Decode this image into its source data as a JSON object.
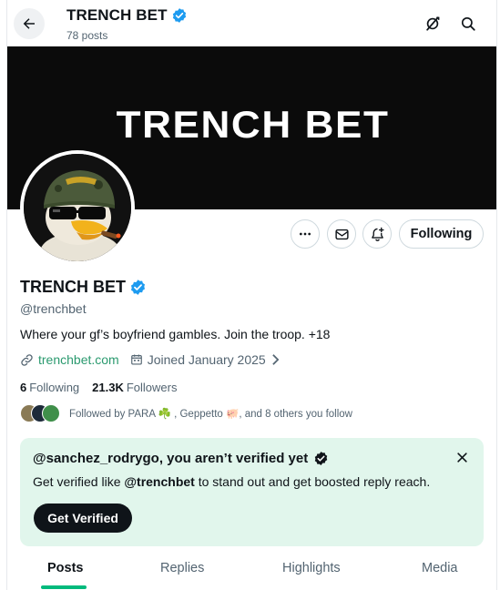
{
  "header": {
    "title": "TRENCH BET",
    "posts_count": "78 posts"
  },
  "banner": {
    "text": "TRENCH BET",
    "background": "#0b0b0b"
  },
  "actions": {
    "following_label": "Following"
  },
  "profile": {
    "name": "TRENCH BET",
    "handle": "@trenchbet",
    "bio": "Where your gf’s boyfriend gambles. Join the troop. +18",
    "website": "trenchbet.com",
    "joined": "Joined January 2025",
    "following_count": "6",
    "following_label": "Following",
    "followers_count": "21.3K",
    "followers_label": "Followers",
    "followed_by": "Followed by PARA ☘️ , Geppetto 🐖, and 8 others you follow"
  },
  "verify_card": {
    "title": "@sanchez_rodrygo, you aren’t verified yet",
    "body_prefix": "Get verified like ",
    "body_handle": "@trenchbet",
    "body_suffix": " to stand out and get boosted reply reach.",
    "button_label": "Get Verified",
    "background": "#e1f6ec"
  },
  "tabs": [
    {
      "label": "Posts",
      "active": true
    },
    {
      "label": "Replies",
      "active": false
    },
    {
      "label": "Highlights",
      "active": false
    },
    {
      "label": "Media",
      "active": false
    }
  ],
  "icons": {
    "back": "arrow-left-icon",
    "grok": "grok-icon",
    "search": "search-icon",
    "verified": "verified-badge-icon",
    "more": "more-icon",
    "mail": "mail-icon",
    "notify": "bell-plus-icon",
    "link": "link-icon",
    "calendar": "calendar-icon",
    "close": "close-icon"
  },
  "colors": {
    "verified_blue": "#1d9bf0",
    "accent_green": "#00ba7c",
    "link_green": "#2b9a6f",
    "text_secondary": "#536471"
  }
}
